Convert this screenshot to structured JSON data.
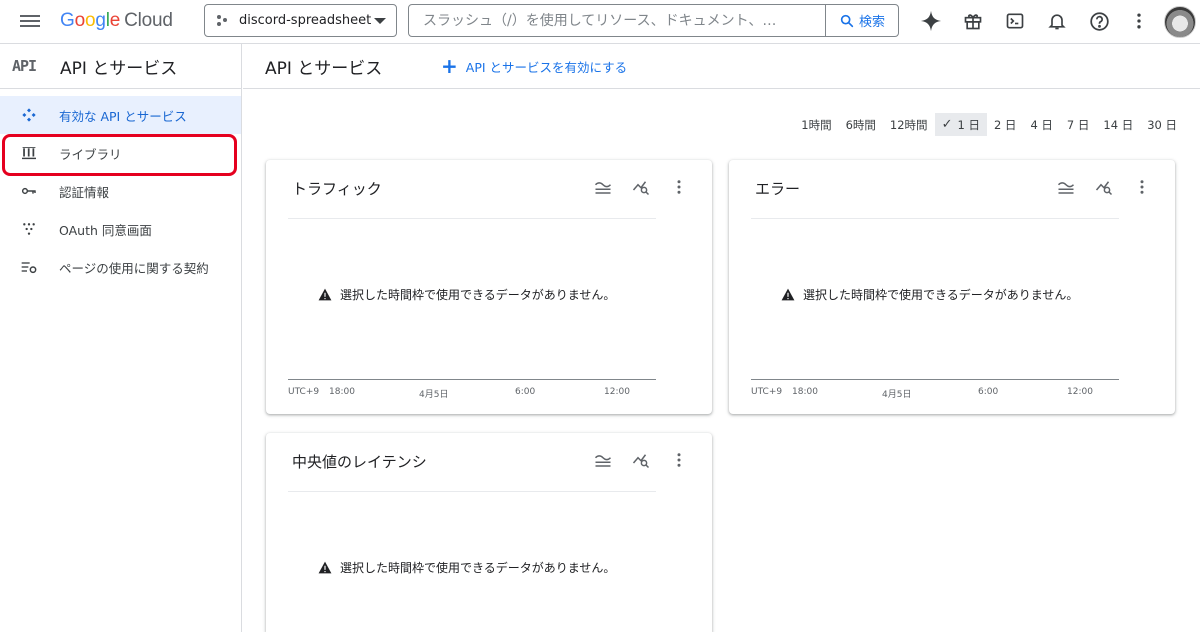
{
  "topbar": {
    "brand": {
      "word": [
        "G",
        "o",
        "o",
        "g",
        "l",
        "e"
      ],
      "product": "Cloud"
    },
    "project": "discord-spreadsheet",
    "search_placeholder": "スラッシュ（/）を使用してリソース、ドキュメント、…",
    "search_button": "検索",
    "icons": [
      "sparkle-icon",
      "gift-icon",
      "terminal-icon",
      "bell-icon",
      "help-icon",
      "more-vert-icon"
    ]
  },
  "sidenav": {
    "badge": "API",
    "title": "API とサービス",
    "items": [
      {
        "label": "有効な API とサービス",
        "icon": "enabled-apis-icon",
        "active": true
      },
      {
        "label": "ライブラリ",
        "icon": "library-icon",
        "active": false
      },
      {
        "label": "認証情報",
        "icon": "key-icon",
        "active": false
      },
      {
        "label": "OAuth 同意画面",
        "icon": "consent-icon",
        "active": false
      },
      {
        "label": "ページの使用に関する契約",
        "icon": "settings-list-icon",
        "active": false
      }
    ]
  },
  "main": {
    "title": "API とサービス",
    "enable_label": "API とサービスを有効にする",
    "ranges": [
      "1時間",
      "6時間",
      "12時間",
      "1 日",
      "2 日",
      "4 日",
      "7 日",
      "14 日",
      "30 日"
    ],
    "selected_range": "1 日",
    "cards": [
      {
        "title": "トラフィック",
        "message": "選択した時間枠で使用できるデータがありません。",
        "ticks": [
          "UTC+9",
          "18:00",
          "4月5日",
          "6:00",
          "12:00"
        ]
      },
      {
        "title": "エラー",
        "message": "選択した時間枠で使用できるデータがありません。",
        "ticks": [
          "UTC+9",
          "18:00",
          "4月5日",
          "6:00",
          "12:00"
        ]
      },
      {
        "title": "中央値のレイテンシ",
        "message": "選択した時間枠で使用できるデータがありません。",
        "ticks": []
      }
    ]
  },
  "colors": {
    "accent": "#1a73e8",
    "active_bg": "#e8f0fe",
    "highlight": "#e5001f"
  }
}
